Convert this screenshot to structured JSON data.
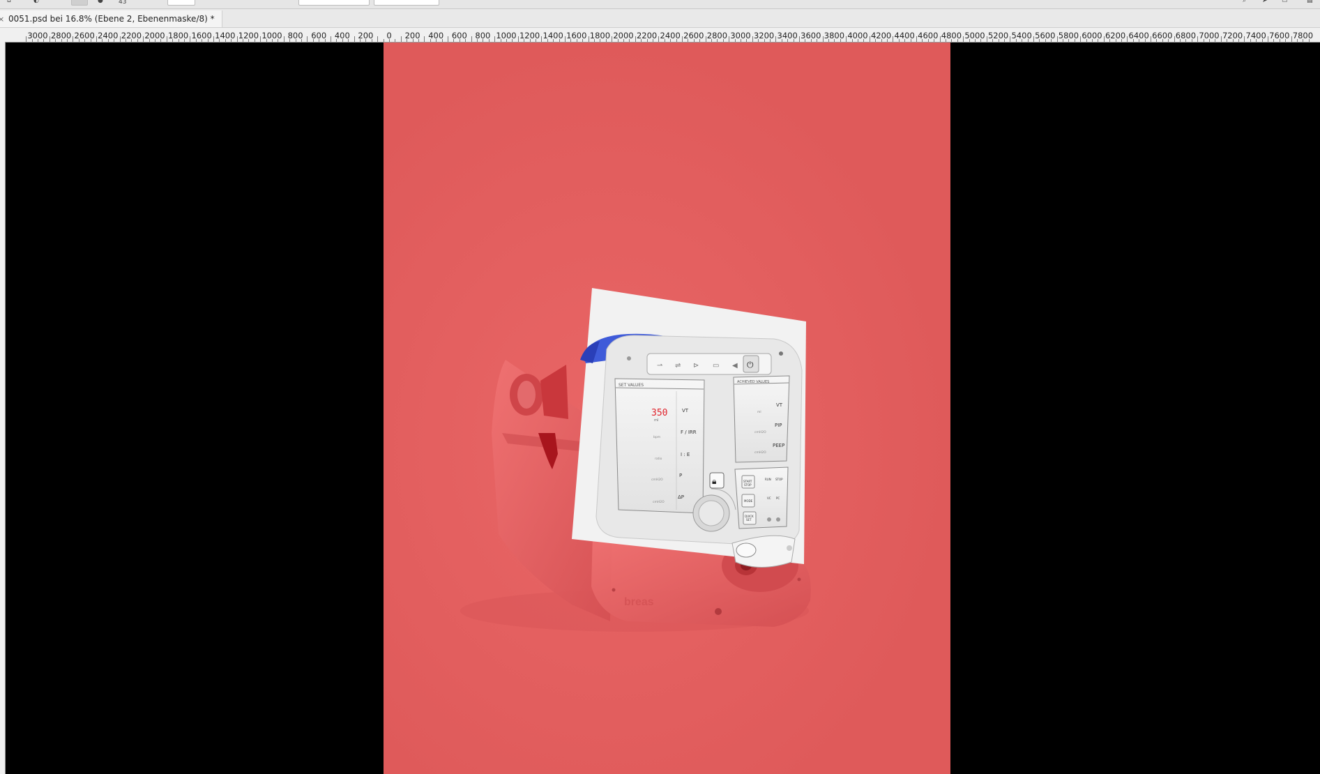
{
  "options_bar": {
    "brush_size": "43"
  },
  "document_tab": {
    "title": "0051.psd bei 16.8% (Ebene 2, Ebenenmaske/8) *"
  },
  "ruler": {
    "labels": [
      "3000",
      "2800",
      "2600",
      "2400",
      "2200",
      "2000",
      "1800",
      "1600",
      "1400",
      "1200",
      "1000",
      "800",
      "600",
      "400",
      "200",
      "0",
      "200",
      "400",
      "600",
      "800",
      "1000",
      "1200",
      "1400",
      "1600",
      "1800",
      "2000",
      "2200",
      "2400",
      "2600",
      "2800",
      "3000",
      "3200",
      "3400",
      "3600",
      "3800",
      "4000",
      "4200",
      "4400",
      "4600",
      "4800",
      "5000",
      "5200",
      "5400",
      "5600",
      "5800",
      "6000",
      "6200",
      "6400",
      "6600",
      "6800",
      "7000",
      "7200",
      "7400",
      "7600",
      "7800"
    ]
  },
  "device_panel": {
    "set_values_title": "SET VALUES",
    "achieved_values_title": "ACHIEVED VALUES",
    "vt_value": "350",
    "vt_unit": "ml",
    "set_labels": [
      "VT",
      "F / IRR",
      "I : E",
      "P",
      "ΔP"
    ],
    "set_sub_labels": [
      "ml",
      "bpm",
      "ratio",
      "cmH2O",
      "cmH2O"
    ],
    "achieved_labels": [
      "VT",
      "PIP",
      "PEEP"
    ],
    "button_labels": [
      "START STOP",
      "MODE",
      "QUICK SET"
    ],
    "status_labels": [
      "RUN",
      "STOP",
      "VC",
      "PC"
    ],
    "brand": "breas"
  },
  "colors": {
    "document_background": "#e85e5e",
    "workspace": "#000000",
    "device_highlight": "#3f5bd9",
    "display_red": "#e0212a"
  }
}
